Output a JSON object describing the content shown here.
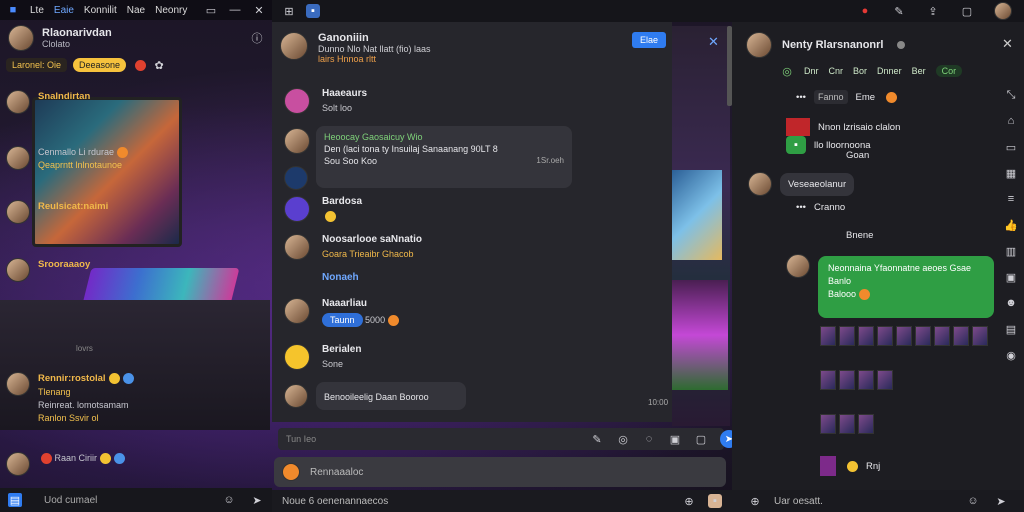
{
  "topbar": {
    "items": [
      "Lte",
      "Eaie",
      "Konnilit",
      "Nae",
      "Neonry"
    ],
    "icons": [
      "window-icon",
      "minimize-icon",
      "restore-icon",
      "close-icon"
    ]
  },
  "left": {
    "header": {
      "name": "Rlaonarivdan",
      "sub": "Clolato"
    },
    "pills": [
      "Laronel: Oie",
      "Deeasone"
    ],
    "messages": [
      {
        "line1": "Snalndirtan"
      },
      {
        "line1": "Cenmallo Li rdurae",
        "line2": "Qeaprntt lnlnotaunoe"
      },
      {
        "line1": "Reulsicat:naimi"
      },
      {
        "line1": "Srooraaaoy"
      },
      {
        "line1": "Rennir:rostolal",
        "line2": "Tlenang",
        "line3": "Reinreat. lomotsamam",
        "line4": "Ranlon Ssvir ol"
      },
      {
        "line1": "Raan Ciriir"
      }
    ],
    "watermark": "lovrs",
    "footer": {
      "text": "Uod cumael"
    }
  },
  "mid": {
    "header": {
      "name": "Ganoniiin",
      "sub": "Dunno Nlo Nat llatt (fio) laas",
      "sub2": "lairs Hnnoa rltt"
    },
    "button": "Elae",
    "rows": [
      {
        "name": "Haaeaurs",
        "sub": "Solt loo"
      },
      {
        "name": "Heoocay Gaosaicuy",
        "bubble1": "Heoocay Gaosaicuy Wio",
        "bubble2": "Den (laci tona ty Insuilaj Sanaanang 90LT 8",
        "bubble3": "Sou Soo Koo",
        "time": "1Sr.oeh"
      },
      {
        "name": "Bardosa",
        "sub": ""
      },
      {
        "name": "Noosarlooe saNnatio",
        "sub": "Goara Trieaibr Ghacob"
      },
      {
        "name": "Nonaeh",
        "sub": ""
      },
      {
        "name": "Naaarliau",
        "chip": "Taunn",
        "chip_after": "5000"
      },
      {
        "name": "Berialen",
        "sub": "Sone"
      },
      {
        "name": "Benooileelig",
        "bubble1": "Benooileelig Daan Booroo"
      }
    ],
    "timestamp2": "10:00",
    "composer": {
      "placeholder": "Tun Ieo"
    },
    "second_bar": {
      "text": "Rennaaaloc"
    },
    "footer": {
      "text": "Noue 6 oenenannaecos"
    }
  },
  "right": {
    "header": {
      "name": "Nenty Rlarsnanonrl"
    },
    "tabs": [
      "Dnr",
      "Cnr",
      "Bor",
      "Dnner",
      "Ber",
      "Cor"
    ],
    "lines": [
      {
        "tag": "Fanno",
        "text": "Eme"
      },
      {
        "text": "Nnon lzrisaio clalon"
      },
      {
        "text": "llo lloornoona"
      },
      {
        "text": "Goan"
      },
      {
        "label": "Veseaeolanur"
      },
      {
        "text": "Cranno"
      },
      {
        "text": "Bnene"
      },
      {
        "text": "Rnj"
      }
    ],
    "green_bubble": {
      "line1": "Neonnaina Yfaonnatne aeoes Gsae",
      "line2": "Banlo",
      "line3": "Balooo"
    },
    "footer": {
      "text": "Uar oesatt."
    }
  }
}
